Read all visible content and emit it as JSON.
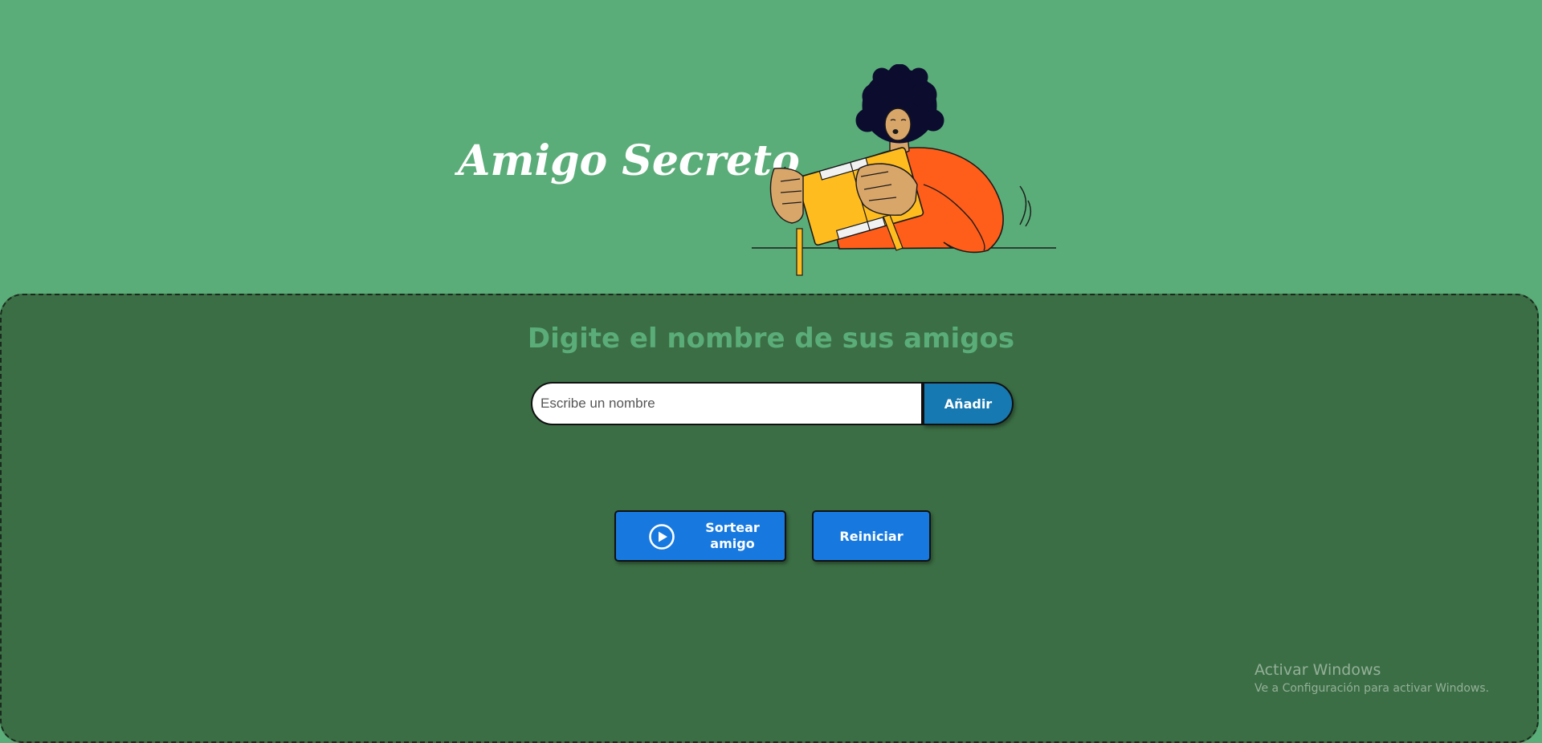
{
  "header": {
    "title": "Amigo Secreto",
    "illustration": "person-holding-gift-box-illustration"
  },
  "main": {
    "section_title": "Digite el nombre de sus amigos",
    "name_input": {
      "placeholder": "Escribe un nombre",
      "value": ""
    },
    "add_button_label": "Añadir",
    "draw_button": {
      "icon": "play-circle-icon",
      "label": "Sortear amigo"
    },
    "reset_button_label": "Reiniciar"
  },
  "watermark": {
    "title": "Activar Windows",
    "subtitle": "Ve a Configuración para activar Windows."
  },
  "colors": {
    "page_background": "#5aad78",
    "panel_background": "#3b6e44",
    "section_title": "#5aad78",
    "add_button": "#1779b1",
    "action_buttons": "#1779e0"
  }
}
